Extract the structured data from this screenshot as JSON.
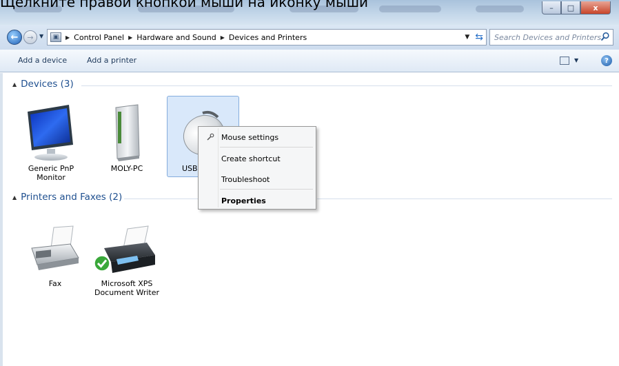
{
  "caption": "Щелкните правой кнопкой мыши на иконку мыши",
  "window": {
    "controls": {
      "minimize": "–",
      "maximize": "□",
      "close": "x"
    }
  },
  "nav": {
    "back_icon": "back-arrow-icon",
    "forward_icon": "forward-arrow-icon",
    "breadcrumbs": [
      "Control Panel",
      "Hardware and Sound",
      "Devices and Printers"
    ],
    "search_placeholder": "Search Devices and Printers"
  },
  "toolbar": {
    "add_device": "Add a device",
    "add_printer": "Add a printer"
  },
  "groups": {
    "devices": {
      "title": "Devices (3)",
      "items": [
        {
          "label_line1": "Generic PnP",
          "label_line2": "Monitor",
          "icon": "monitor-icon"
        },
        {
          "label_line1": "MOLY-PC",
          "label_line2": "",
          "icon": "pc-tower-icon"
        },
        {
          "label_line1": "USB",
          "label_line2": "",
          "icon": "mouse-icon",
          "selected": true
        }
      ]
    },
    "printers": {
      "title": "Printers and Faxes (2)",
      "items": [
        {
          "label_line1": "Fax",
          "label_line2": "",
          "icon": "fax-icon"
        },
        {
          "label_line1": "Microsoft XPS",
          "label_line2": "Document Writer",
          "icon": "printer-icon",
          "default": true
        }
      ]
    }
  },
  "context_menu": {
    "items": [
      "Mouse settings",
      "Create shortcut",
      "Troubleshoot",
      "Properties"
    ]
  },
  "colors": {
    "accent": "#1e4f8f",
    "selection": "#d9e8fa",
    "default_check": "#3aa83a"
  }
}
